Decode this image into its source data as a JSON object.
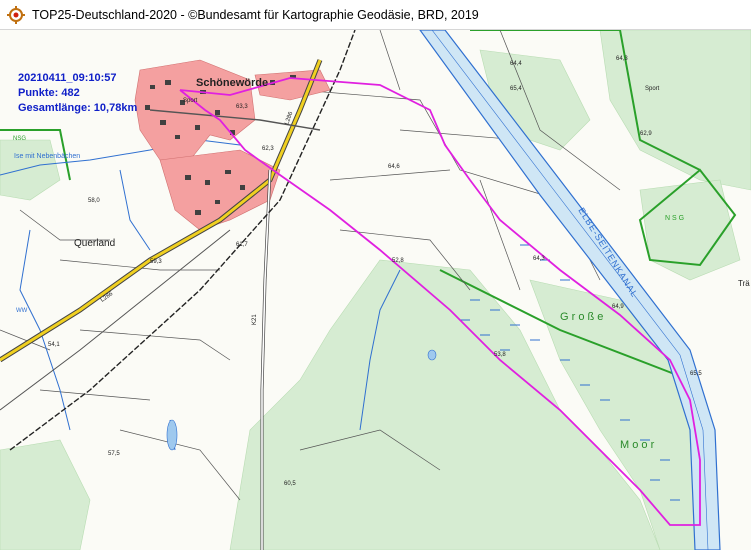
{
  "window": {
    "title": "TOP25-Deutschland-2020 - ©Bundesamt für Kartographie Geodäsie, BRD, 2019",
    "icon": "map-target-icon"
  },
  "track_info": {
    "timestamp": "20210411_09:10:57",
    "points": "Punkte: 482",
    "total_length": "Gesamtlänge: 10,78km"
  },
  "map_labels": {
    "town": "Schönewörde",
    "locality": "Querland",
    "canal": "ELBE-SEITENKANAL",
    "stream": "Ise mit Nebenbächen",
    "moor_1": "G r o ß e",
    "moor_2": "M o o r",
    "nsg_1": "NSG",
    "nsg_2": "N S G",
    "sport_1": "Sport",
    "sport_2": "Sport",
    "road_1": "L286",
    "road_2": "L286",
    "road_3": "K21",
    "heights": [
      "64,4",
      "65,4",
      "62,3",
      "64,6",
      "63,3",
      "64,3",
      "61,7",
      "52,8",
      "64,9",
      "59,3",
      "58,0",
      "54,1",
      "62,9",
      "57,5",
      "60,5",
      "65,5",
      "64,3",
      "53,8"
    ],
    "edge_1": "Trä",
    "edge_2": "WW"
  },
  "colors": {
    "track": "#e020e0",
    "settlement": "#f4a0a0",
    "forest": "#d6ecd2",
    "water": "#3070d0",
    "canal_fill": "#cfe6f5",
    "nsg_border": "#2aa02a",
    "road_yellow": "#f0d020",
    "overlay_text": "#1020c8"
  }
}
